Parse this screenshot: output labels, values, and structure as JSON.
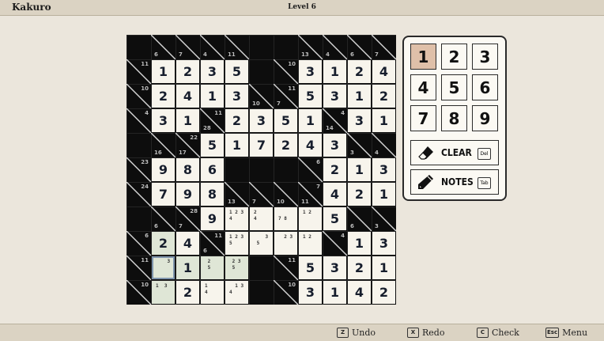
{
  "header": {
    "title": "Kakuro",
    "level": "Level 6"
  },
  "footer": {
    "undo": {
      "key": "Z",
      "label": "Undo"
    },
    "redo": {
      "key": "X",
      "label": "Redo"
    },
    "check": {
      "key": "C",
      "label": "Check"
    },
    "menu": {
      "key": "Esc",
      "label": "Menu"
    }
  },
  "panel": {
    "numbers": [
      "1",
      "2",
      "3",
      "4",
      "5",
      "6",
      "7",
      "8",
      "9"
    ],
    "active_number": "1",
    "clear": {
      "label": "CLEAR",
      "key": "Del"
    },
    "notes": {
      "label": "NOTES",
      "key": "Tab"
    }
  },
  "board": {
    "size": 11,
    "rows": [
      [
        "B",
        {
          "c": [
            "6",
            ""
          ]
        },
        {
          "c": [
            "7",
            ""
          ]
        },
        {
          "c": [
            "4",
            ""
          ]
        },
        {
          "c": [
            "11",
            ""
          ]
        },
        "B",
        "B",
        {
          "c": [
            "13",
            ""
          ]
        },
        {
          "c": [
            "4",
            ""
          ]
        },
        {
          "c": [
            "6",
            ""
          ]
        },
        {
          "c": [
            "7",
            ""
          ]
        }
      ],
      [
        {
          "c": [
            "",
            "11"
          ]
        },
        "1",
        "2",
        "3",
        "5",
        "B",
        {
          "c": [
            "",
            "10"
          ]
        },
        "3",
        "1",
        "2",
        "4"
      ],
      [
        {
          "c": [
            "",
            "10"
          ]
        },
        "2",
        "4",
        "1",
        "3",
        {
          "c": [
            "10",
            ""
          ]
        },
        {
          "c": [
            "7",
            "11"
          ]
        },
        "5",
        "3",
        "1",
        "2"
      ],
      [
        {
          "c": [
            "",
            "4"
          ]
        },
        "3",
        "1",
        {
          "c": [
            "28",
            "11"
          ]
        },
        "2",
        "3",
        "5",
        "1",
        {
          "c": [
            "14",
            "4"
          ]
        },
        "3",
        "1"
      ],
      [
        "B",
        {
          "c": [
            "16",
            ""
          ]
        },
        {
          "c": [
            "17",
            "22"
          ]
        },
        "5",
        "1",
        "7",
        "2",
        "4",
        "3",
        {
          "c": [
            "3",
            ""
          ]
        },
        {
          "c": [
            "4",
            ""
          ]
        }
      ],
      [
        {
          "c": [
            "",
            "23"
          ]
        },
        "9",
        "8",
        "6",
        "B",
        "B",
        "B",
        {
          "c": [
            "",
            "6"
          ]
        },
        "2",
        "1",
        "3"
      ],
      [
        {
          "c": [
            "",
            "24"
          ]
        },
        "7",
        "9",
        "8",
        {
          "c": [
            "13",
            ""
          ]
        },
        {
          "c": [
            "7",
            ""
          ]
        },
        {
          "c": [
            "10",
            ""
          ]
        },
        {
          "c": [
            "11",
            "7"
          ]
        },
        "4",
        "2",
        "1"
      ],
      [
        "B",
        {
          "c": [
            "6",
            ""
          ]
        },
        {
          "c": [
            "7",
            "28"
          ]
        },
        "9",
        {
          "n": "1 2 3\n4"
        },
        {
          "n": "2\n4"
        },
        {
          "n": "\n7 8"
        },
        {
          "n": "1 2"
        },
        "5",
        {
          "c": [
            "6",
            ""
          ]
        },
        {
          "c": [
            "3",
            ""
          ]
        }
      ],
      [
        {
          "c": [
            "",
            "6"
          ]
        },
        {
          "v": "2",
          "s": 1
        },
        "4",
        {
          "c": [
            "6",
            "11"
          ]
        },
        {
          "n": "1 2 3\n5"
        },
        {
          "n": "    3\n 5"
        },
        {
          "n": "  2 3"
        },
        {
          "n": "1 2"
        },
        {
          "c": [
            "",
            "4"
          ]
        },
        "1",
        "3"
      ],
      [
        {
          "c": [
            "",
            "11"
          ]
        },
        {
          "n": "    3",
          "s": 1,
          "cur": 1
        },
        {
          "v": "1",
          "s": 1
        },
        {
          "n": " 2\n 5",
          "s": 1
        },
        {
          "n": " 2 3\n 5",
          "s": 1
        },
        "B",
        {
          "c": [
            "",
            "11"
          ]
        },
        "5",
        "3",
        "2",
        "1"
      ],
      [
        {
          "c": [
            "",
            "10"
          ]
        },
        {
          "n": "1  3",
          "s": 1
        },
        "2",
        {
          "n": "1\n4"
        },
        {
          "n": "  1 3\n4"
        },
        "B",
        {
          "c": [
            "",
            "10"
          ]
        },
        "3",
        "1",
        "4",
        "2"
      ]
    ]
  },
  "colors": {
    "background": "#ebe6dc",
    "active_button": "#dfc0a9",
    "selected_cells": "#dfe6d6",
    "digit": "#161d2c"
  }
}
